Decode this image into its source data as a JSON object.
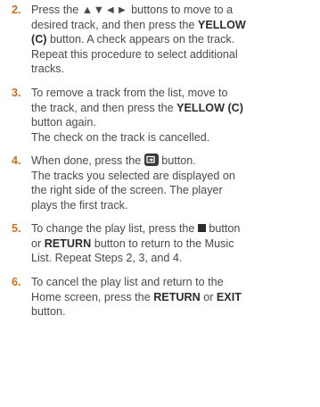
{
  "steps": [
    {
      "number": "2.",
      "l1a": "Press the",
      "l1b": "▲▼◄►",
      "l1c": "buttons to move to a",
      "l2a": "desired track, and then press the",
      "l2b": "YELLOW",
      "l3a": "(C)",
      "l3b": "button. A check appears on the track.",
      "l4": "Repeat this procedure to select additional",
      "l5": "tracks."
    },
    {
      "number": "3.",
      "l1": "To remove a track from the list, move to",
      "l2a": "the track, and then press the",
      "l2b": "YELLOW (C)",
      "l3": "button again.",
      "l4": "The check on the track is cancelled."
    },
    {
      "number": "4.",
      "l1a": "When done, press the",
      "l1b": "button.",
      "icon": "enter-icon",
      "l2": "The tracks you selected are displayed on",
      "l3": "the right side of the screen. The player",
      "l4": "plays the first track."
    },
    {
      "number": "5.",
      "l1a": "To change the play list, press the",
      "l1b": "button",
      "icon": "stop-icon",
      "l2a": "or",
      "l2b": "RETURN",
      "l2c": "button to return to the Music",
      "l3": "List. Repeat Steps 2, 3, and 4."
    },
    {
      "number": "6.",
      "l1": "To cancel the play list and return to the",
      "l2a": "Home screen, press the",
      "l2b": "RETURN",
      "l2c": "or",
      "l2d": "EXIT",
      "l3": "button."
    }
  ]
}
